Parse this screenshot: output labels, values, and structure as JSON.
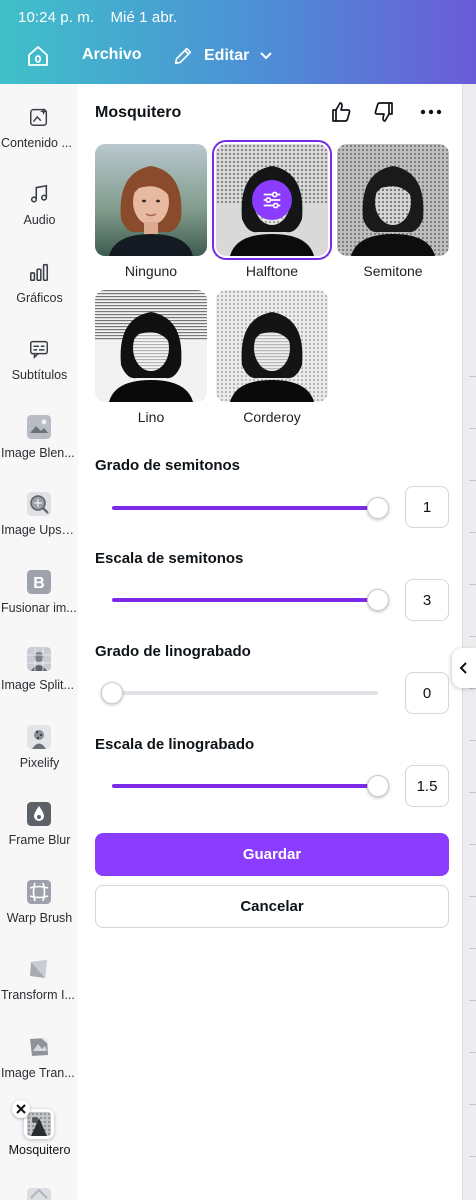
{
  "status": {
    "time": "10:24 p. m.",
    "date": "Mié 1 abr."
  },
  "topnav": {
    "archivo": "Archivo",
    "editar": "Editar"
  },
  "sidebar": {
    "items": [
      {
        "label": "Contenido ...",
        "icon": "magic-media-icon"
      },
      {
        "label": "Audio",
        "icon": "music-note-icon"
      },
      {
        "label": "Gráficos",
        "icon": "bar-chart-icon"
      },
      {
        "label": "Subtítulos",
        "icon": "captions-icon"
      },
      {
        "label": "Image Blen...",
        "icon": "image-blend-icon"
      },
      {
        "label": "Image Upsc...",
        "icon": "image-upscale-icon"
      },
      {
        "label": "Fusionar im...",
        "icon": "merge-b-icon"
      },
      {
        "label": "Image Split...",
        "icon": "image-split-icon"
      },
      {
        "label": "Pixelify",
        "icon": "pixelify-icon"
      },
      {
        "label": "Frame Blur",
        "icon": "drop-icon"
      },
      {
        "label": "Warp Brush",
        "icon": "warp-brush-icon"
      },
      {
        "label": "Transform I...",
        "icon": "transform-icon"
      },
      {
        "label": "Image Tran...",
        "icon": "image-transform-icon"
      },
      {
        "label": "Mosquitero",
        "icon": "mosquitero-icon"
      }
    ]
  },
  "panel": {
    "title": "Mosquitero",
    "effects": [
      {
        "label": "Ninguno",
        "selected": false
      },
      {
        "label": "Halftone",
        "selected": true
      },
      {
        "label": "Semitone",
        "selected": false
      },
      {
        "label": "Lino",
        "selected": false
      },
      {
        "label": "Corderoy",
        "selected": false
      }
    ],
    "controls": [
      {
        "label": "Grado de semitonos",
        "value": "1",
        "fill": 1.0
      },
      {
        "label": "Escala de semitonos",
        "value": "3",
        "fill": 1.0
      },
      {
        "label": "Grado de linograbado",
        "value": "0",
        "fill": 0.0
      },
      {
        "label": "Escala de linograbado",
        "value": "1.5",
        "fill": 1.0
      }
    ],
    "save": "Guardar",
    "cancel": "Cancelar"
  },
  "colors": {
    "accent": "#8b3dff",
    "slider": "#7d2ae8"
  }
}
